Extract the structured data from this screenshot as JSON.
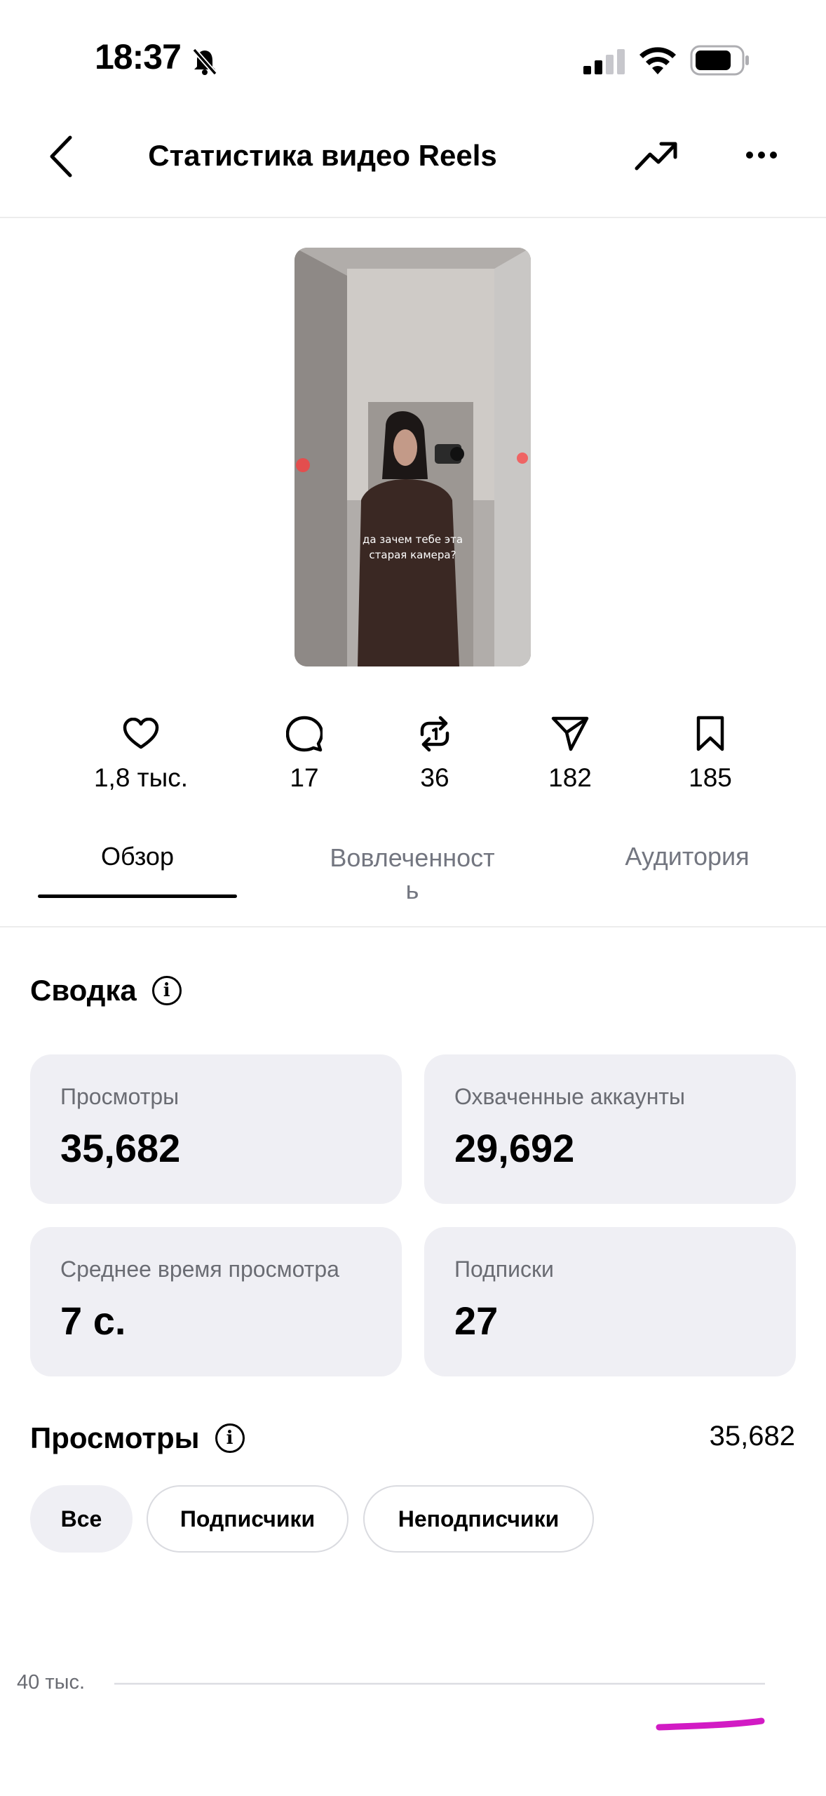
{
  "status_bar": {
    "time": "18:37"
  },
  "header": {
    "title": "Статистика видео Reels"
  },
  "thumbnail": {
    "caption_line1": "да зачем тебе эта",
    "caption_line2": "старая камера?"
  },
  "stats": [
    {
      "icon": "heart-icon",
      "value": "1,8 тыс."
    },
    {
      "icon": "comment-icon",
      "value": "17"
    },
    {
      "icon": "repost-icon",
      "value": "36"
    },
    {
      "icon": "share-icon",
      "value": "182"
    },
    {
      "icon": "bookmark-icon",
      "value": "185"
    }
  ],
  "tabs": [
    {
      "label": "Обзор",
      "active": true
    },
    {
      "label_line1": "Вовлеченност",
      "label_line2": "ь",
      "active": false
    },
    {
      "label": "Аудитория",
      "active": false
    }
  ],
  "summary": {
    "title": "Сводка",
    "cards": [
      {
        "label": "Просмотры",
        "value": "35,682"
      },
      {
        "label": "Охваченные аккаунты",
        "value": "29,692"
      },
      {
        "label": "Среднее время просмотра",
        "value": "7 с."
      },
      {
        "label": "Подписки",
        "value": "27"
      }
    ]
  },
  "views": {
    "title": "Просмотры",
    "total": "35,682",
    "filters": [
      "Все",
      "Подписчики",
      "Неподписчики"
    ],
    "selected_filter": "Все"
  },
  "chart_data": {
    "type": "line",
    "y_tick_labels": [
      "40 тыс."
    ],
    "series_color": "#d21bc4"
  },
  "colors": {
    "accent": "#d21bc4",
    "card_bg": "#efeff4",
    "muted_text": "#6a6c73"
  }
}
